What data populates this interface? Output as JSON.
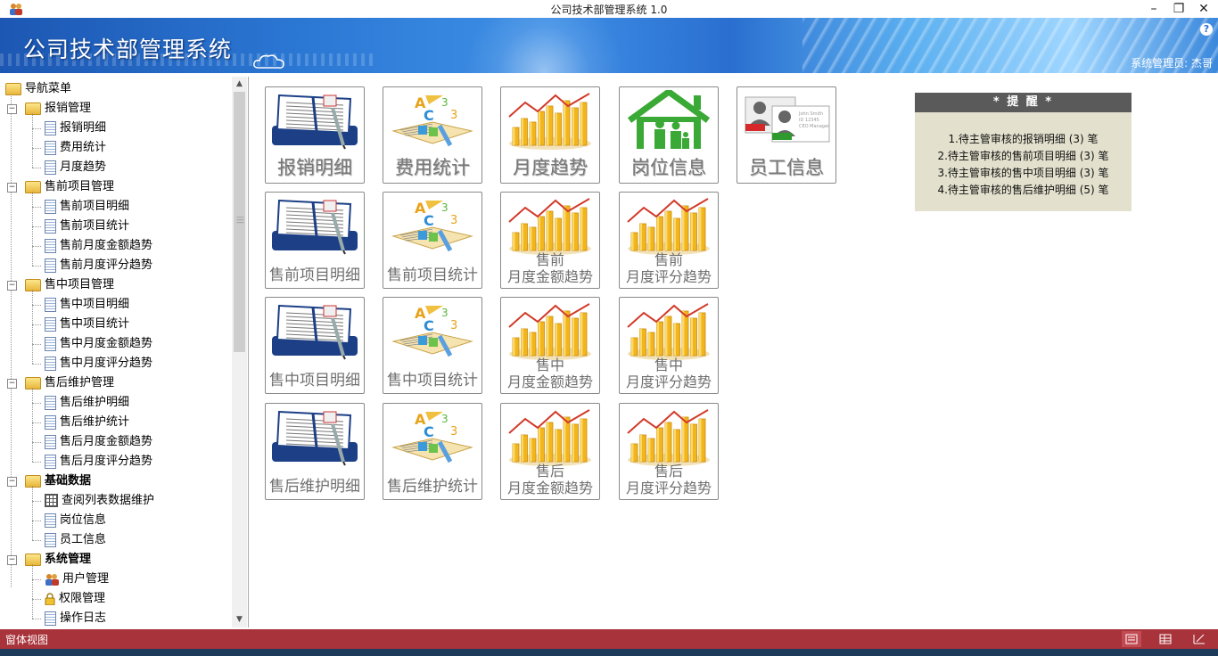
{
  "window": {
    "title": "公司技术部管理系统 1.0"
  },
  "banner": {
    "title": "公司技术部管理系统",
    "help": "?",
    "user": "系统管理员: 杰哥"
  },
  "nav": {
    "root": "导航菜单",
    "items": [
      {
        "label": "报销管理",
        "level": 1,
        "type": "folder",
        "bold": false
      },
      {
        "label": "报销明细",
        "level": 2,
        "type": "doc"
      },
      {
        "label": "费用统计",
        "level": 2,
        "type": "doc"
      },
      {
        "label": "月度趋势",
        "level": 2,
        "type": "doc"
      },
      {
        "label": "售前项目管理",
        "level": 1,
        "type": "folder",
        "bold": false
      },
      {
        "label": "售前项目明细",
        "level": 2,
        "type": "doc"
      },
      {
        "label": "售前项目统计",
        "level": 2,
        "type": "doc"
      },
      {
        "label": "售前月度金额趋势",
        "level": 2,
        "type": "doc"
      },
      {
        "label": "售前月度评分趋势",
        "level": 2,
        "type": "doc"
      },
      {
        "label": "售中项目管理",
        "level": 1,
        "type": "folder",
        "bold": false
      },
      {
        "label": "售中项目明细",
        "level": 2,
        "type": "doc"
      },
      {
        "label": "售中项目统计",
        "level": 2,
        "type": "doc"
      },
      {
        "label": "售中月度金额趋势",
        "level": 2,
        "type": "doc"
      },
      {
        "label": "售中月度评分趋势",
        "level": 2,
        "type": "doc"
      },
      {
        "label": "售后维护管理",
        "level": 1,
        "type": "folder",
        "bold": false
      },
      {
        "label": "售后维护明细",
        "level": 2,
        "type": "doc"
      },
      {
        "label": "售后维护统计",
        "level": 2,
        "type": "doc"
      },
      {
        "label": "售后月度金额趋势",
        "level": 2,
        "type": "doc"
      },
      {
        "label": "售后月度评分趋势",
        "level": 2,
        "type": "doc"
      },
      {
        "label": "基础数据",
        "level": 1,
        "type": "folder",
        "bold": true
      },
      {
        "label": "查阅列表数据维护",
        "level": 2,
        "type": "grid"
      },
      {
        "label": "岗位信息",
        "level": 2,
        "type": "doc"
      },
      {
        "label": "员工信息",
        "level": 2,
        "type": "doc"
      },
      {
        "label": "系统管理",
        "level": 1,
        "type": "folder",
        "bold": true
      },
      {
        "label": "用户管理",
        "level": 2,
        "type": "users"
      },
      {
        "label": "权限管理",
        "level": 2,
        "type": "lock"
      },
      {
        "label": "操作日志",
        "level": 2,
        "type": "doc"
      }
    ]
  },
  "tiles": {
    "row1": [
      {
        "label": "报销明细",
        "art": "notebook",
        "style": "big"
      },
      {
        "label": "费用统计",
        "art": "abc",
        "style": "big"
      },
      {
        "label": "月度趋势",
        "art": "bars",
        "style": "big"
      },
      {
        "label": "岗位信息",
        "art": "house",
        "style": "big"
      },
      {
        "label": "员工信息",
        "art": "card",
        "style": "big"
      }
    ],
    "row2": [
      {
        "label": "售前项目明细",
        "art": "notebook",
        "style": "mid"
      },
      {
        "label": "售前项目统计",
        "art": "abc",
        "style": "mid"
      },
      {
        "label": "售前",
        "label2": "月度金额趋势",
        "art": "bars",
        "style": "two"
      },
      {
        "label": "售前",
        "label2": "月度评分趋势",
        "art": "bars",
        "style": "two"
      }
    ],
    "row3": [
      {
        "label": "售中项目明细",
        "art": "notebook",
        "style": "mid"
      },
      {
        "label": "售中项目统计",
        "art": "abc",
        "style": "mid"
      },
      {
        "label": "售中",
        "label2": "月度金额趋势",
        "art": "bars",
        "style": "two"
      },
      {
        "label": "售中",
        "label2": "月度评分趋势",
        "art": "bars",
        "style": "two"
      }
    ],
    "row4": [
      {
        "label": "售后维护明细",
        "art": "notebook",
        "style": "mid"
      },
      {
        "label": "售后维护统计",
        "art": "abc",
        "style": "mid"
      },
      {
        "label": "售后",
        "label2": "月度金额趋势",
        "art": "bars",
        "style": "two"
      },
      {
        "label": "售后",
        "label2": "月度评分趋势",
        "art": "bars",
        "style": "two"
      }
    ]
  },
  "reminder": {
    "title": "* 提 醒 *",
    "lines": [
      "1.待主管审核的报销明细 (3) 笔",
      "2.待主管审核的售前项目明细 (3) 笔",
      "3.待主管审核的售中项目明细 (3) 笔",
      "4.待主管审核的售后维护明细 (5) 笔"
    ]
  },
  "status": {
    "text": "窗体视图"
  },
  "colors": {
    "accent": "#a8333a",
    "banner": "#2b78d4",
    "reminder_bg": "#e3e1cd"
  }
}
